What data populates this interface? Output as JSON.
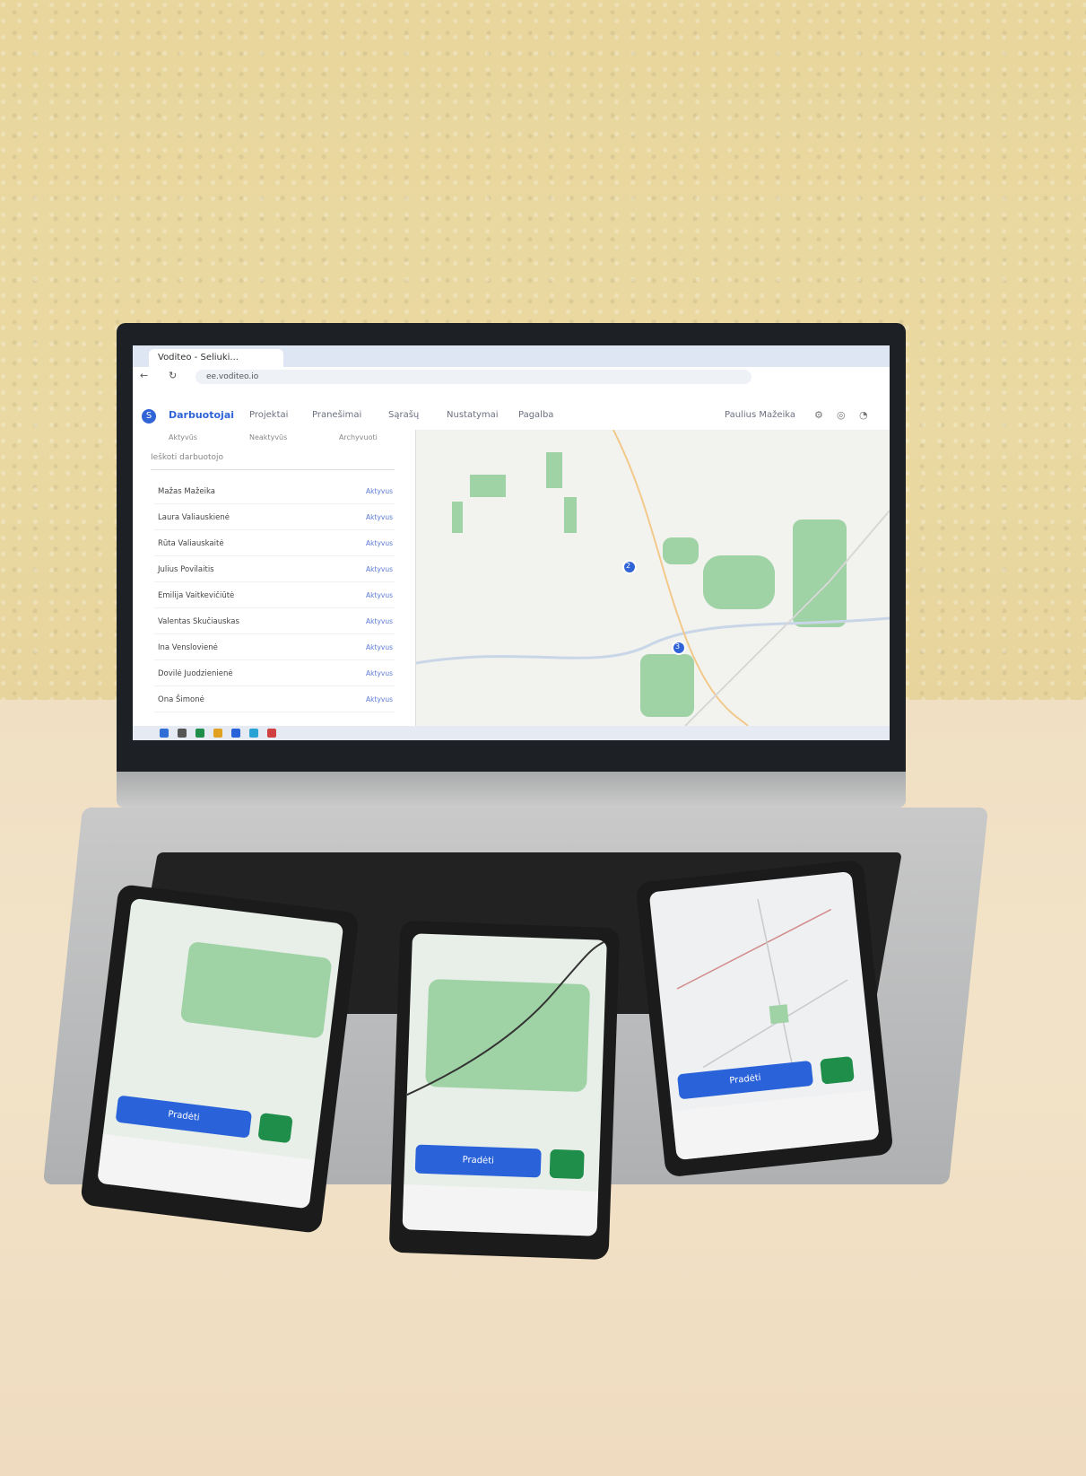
{
  "browser": {
    "tab_title": "Voditeo - Seliuki...",
    "url": "ee.voditeo.io"
  },
  "app": {
    "logo_glyph": "S",
    "brand": "Darbuotojai",
    "nav": [
      "Projektai",
      "Pranešimai",
      "Sąrašų",
      "Nustatymai",
      "Pagalba"
    ],
    "user": "Paulius Mažeika"
  },
  "panel": {
    "subtabs": [
      "Aktyvūs",
      "Neaktyvūs",
      "Archyvuoti"
    ],
    "search_placeholder": "Ieškoti darbuotojo",
    "rows": [
      {
        "name": "Mažas Mažeika",
        "status": "Aktyvus"
      },
      {
        "name": "Laura Valiauskienė",
        "status": "Aktyvus"
      },
      {
        "name": "Rūta Valiauskaitė",
        "status": "Aktyvus"
      },
      {
        "name": "Julius Povilaitis",
        "status": "Aktyvus"
      },
      {
        "name": "Emilija Vaitkevičiūtė",
        "status": "Aktyvus"
      },
      {
        "name": "Valentas Skučiauskas",
        "status": "Aktyvus"
      },
      {
        "name": "Ina Venslovienė",
        "status": "Aktyvus"
      },
      {
        "name": "Dovilė Juodzienienė",
        "status": "Aktyvus"
      },
      {
        "name": "Ona Šimonė",
        "status": "Aktyvus"
      }
    ]
  },
  "map": {
    "pins": [
      "2",
      "3"
    ]
  },
  "phones": {
    "button_label": "Pradėti"
  },
  "colors": {
    "accent": "#2f63d6",
    "forest": "#9fd2a4",
    "green_button": "#1f8e4a"
  }
}
